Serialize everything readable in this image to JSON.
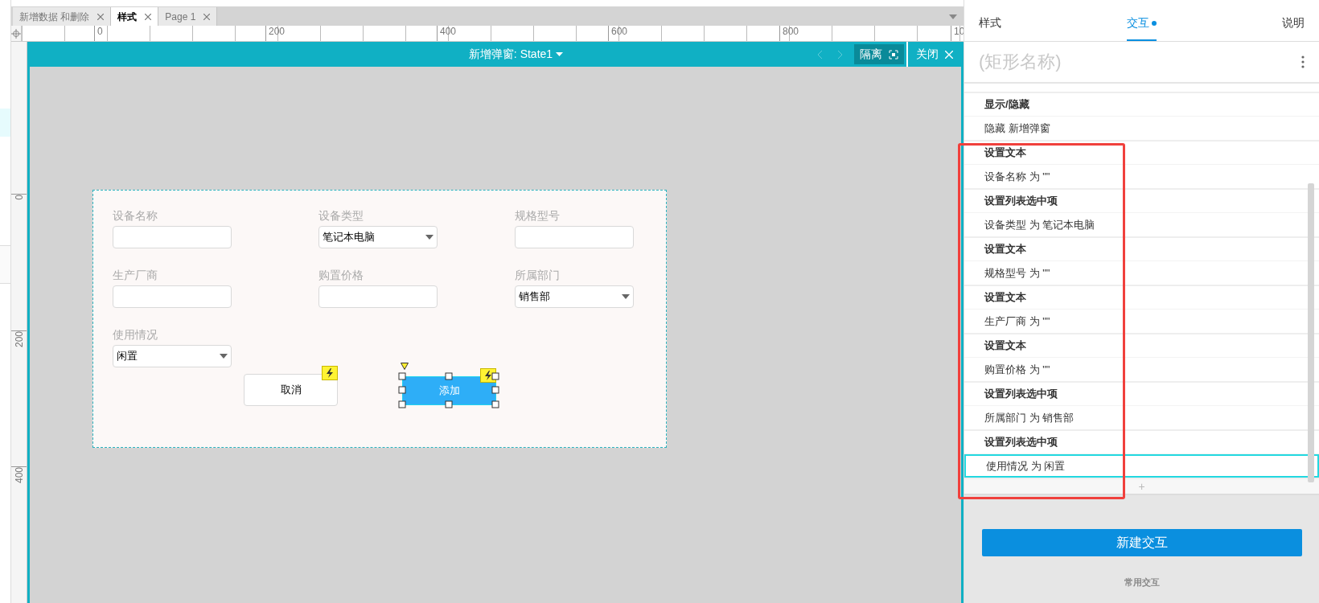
{
  "doc_tabs": [
    {
      "label": "新增数据 和删除",
      "selected": false
    },
    {
      "label": "样式",
      "selected": true
    },
    {
      "label": "Page 1",
      "selected": false
    }
  ],
  "ruler": {
    "h_labels": [
      "0",
      "200",
      "400",
      "600",
      "800",
      "10"
    ],
    "v_labels": [
      "0",
      "200",
      "400"
    ]
  },
  "state_bar": {
    "title": "新增弹窗: State1",
    "isolate": "隔离",
    "close": "关闭"
  },
  "form": {
    "fields": [
      {
        "label": "设备名称",
        "kind": "text"
      },
      {
        "label": "设备类型",
        "kind": "select",
        "value": "笔记本电脑"
      },
      {
        "label": "规格型号",
        "kind": "text"
      },
      {
        "label": "生产厂商",
        "kind": "text"
      },
      {
        "label": "购置价格",
        "kind": "text"
      },
      {
        "label": "所属部门",
        "kind": "select",
        "value": "销售部"
      },
      {
        "label": "使用情况",
        "kind": "select",
        "value": "闲置"
      }
    ],
    "buttons": [
      {
        "label": "取消",
        "kind": "secondary",
        "selected": false
      },
      {
        "label": "添加",
        "kind": "primary",
        "selected": true
      }
    ]
  },
  "panel": {
    "tabs": [
      {
        "label": "样式",
        "selected": false,
        "dot": false
      },
      {
        "label": "交互",
        "selected": true,
        "dot": true
      },
      {
        "label": "说明",
        "selected": false,
        "dot": false
      }
    ],
    "name_placeholder": "(矩形名称)",
    "actions": [
      {
        "title": "显示/隐藏",
        "detail": "隐藏 新增弹窗",
        "selected": false
      },
      {
        "title": "设置文本",
        "detail": "设备名称 为 \"\"",
        "selected": false
      },
      {
        "title": "设置列表选中项",
        "detail": "设备类型 为 笔记本电脑",
        "selected": false
      },
      {
        "title": "设置文本",
        "detail": "规格型号 为 \"\"",
        "selected": false
      },
      {
        "title": "设置文本",
        "detail": "生产厂商 为 \"\"",
        "selected": false
      },
      {
        "title": "设置文本",
        "detail": "购置价格 为 \"\"",
        "selected": false
      },
      {
        "title": "设置列表选中项",
        "detail": "所属部门 为 销售部",
        "selected": false
      },
      {
        "title": "设置列表选中项",
        "detail": "使用情况 为 闲置",
        "selected": true
      }
    ],
    "add_symbol": "+",
    "new_button": "新建交互",
    "common_label": "常用交互"
  }
}
